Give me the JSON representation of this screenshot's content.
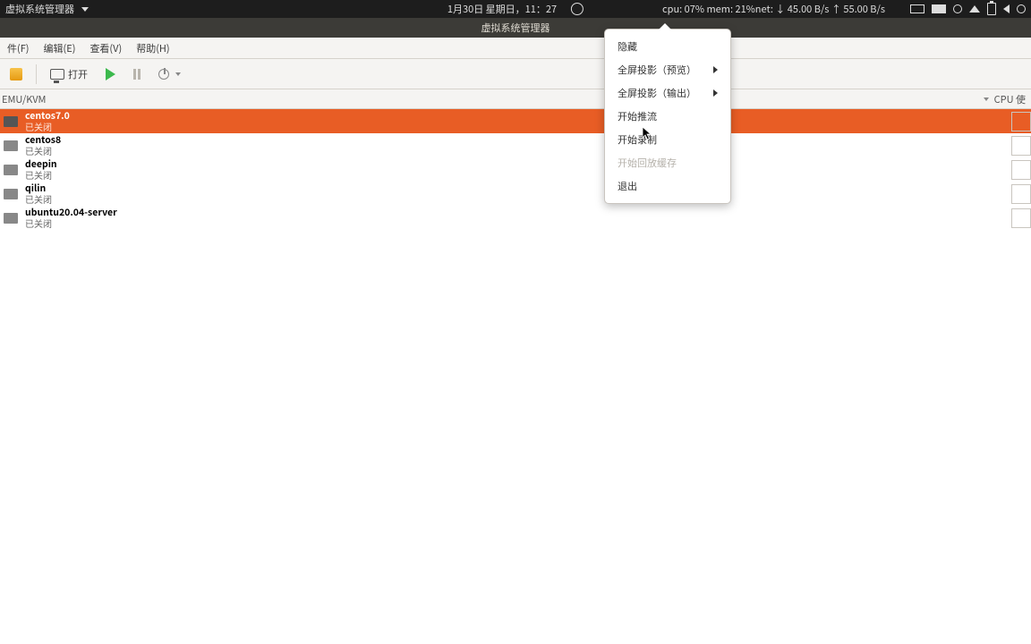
{
  "topbar": {
    "app_title": "虚拟系统管理器",
    "datetime": "1月30日 星期日，11：27",
    "stats": "cpu: 07% mem: 21%net: ↓   45.00 B/s  ↑   55.00 B/s"
  },
  "titlebar": {
    "text": "虚拟系统管理器"
  },
  "menubar": {
    "file": "件(F)",
    "edit": "编辑(E)",
    "view": "查看(V)",
    "help": "帮助(H)"
  },
  "toolbar": {
    "open": "打开"
  },
  "columns": {
    "connection": "EMU/KVM",
    "cpu": "CPU 使"
  },
  "vms": [
    {
      "name": "centos7.0",
      "state": "已关闭",
      "selected": true
    },
    {
      "name": "centos8",
      "state": "已关闭",
      "selected": false
    },
    {
      "name": "deepin",
      "state": "已关闭",
      "selected": false
    },
    {
      "name": "qilin",
      "state": "已关闭",
      "selected": false
    },
    {
      "name": "ubuntu20.04-server",
      "state": "已关闭",
      "selected": false
    }
  ],
  "popup": {
    "hide": "隐藏",
    "fullscreen_preview": "全屏投影（预览）",
    "fullscreen_output": "全屏投影（输出）",
    "start_stream": "开始推流",
    "start_record": "开始录制",
    "start_replay_buffer": "开始回放缓存",
    "exit": "退出"
  }
}
